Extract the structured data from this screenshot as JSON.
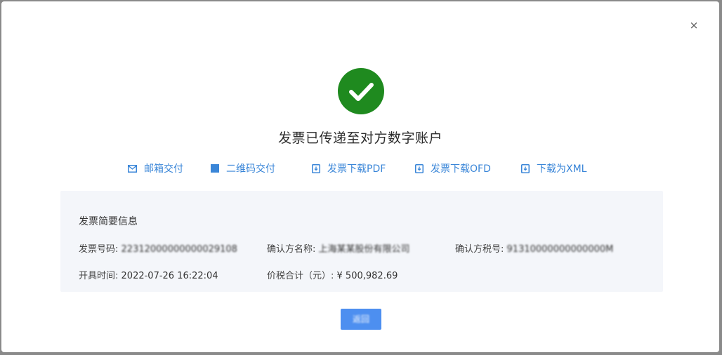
{
  "dialog": {
    "close_glyph": "×",
    "headline": "发票已传递至对方数字账户",
    "accent_color": "#3a86d8",
    "success_color": "#1f8a1f",
    "actions": [
      {
        "label": "邮箱交付",
        "icon": "mail-icon"
      },
      {
        "label": "二维码交付",
        "icon": "qr-code-icon"
      },
      {
        "label": "发票下载PDF",
        "icon": "download-icon"
      },
      {
        "label": "发票下载OFD",
        "icon": "download-icon"
      },
      {
        "label": "下载为XML",
        "icon": "download-icon"
      }
    ],
    "summary": {
      "title": "发票简要信息",
      "invoice_number": {
        "label": "发票号码:",
        "value": "22312000000000029108"
      },
      "buyer_name": {
        "label": "确认方名称:",
        "value": "上海某某股份有限公司"
      },
      "buyer_tax_id": {
        "label": "确认方税号:",
        "value": "91310000000000000M"
      },
      "issue_time": {
        "label": "开具时间:",
        "value": "2022-07-26 16:22:04"
      },
      "total": {
        "label": "价税合计（元）:",
        "value": "¥ 500,982.69"
      }
    },
    "return_label": "返回"
  }
}
